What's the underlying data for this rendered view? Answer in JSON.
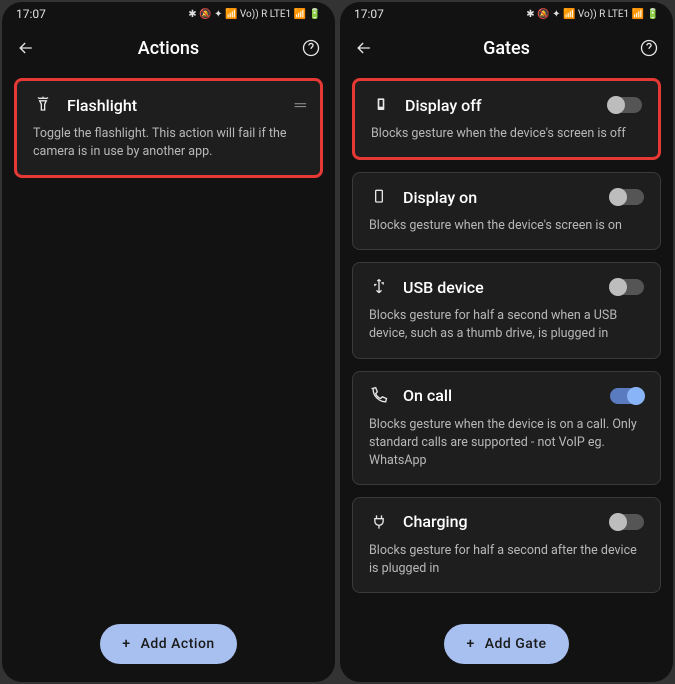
{
  "status": {
    "time": "17:07",
    "indicators": "✱ 🔕 ✦ 📶 Vo)) R LTE1 📶 🔋"
  },
  "left": {
    "title": "Actions",
    "card": {
      "title": "Flashlight",
      "desc": "Toggle the flashlight. This action will fail if the camera is in use by another app."
    },
    "fab": "Add Action"
  },
  "right": {
    "title": "Gates",
    "cards": [
      {
        "title": "Display off",
        "desc": "Blocks gesture when the device's screen is off",
        "on": false,
        "highlight": true,
        "icon": "display-off"
      },
      {
        "title": "Display on",
        "desc": "Blocks gesture when the device's screen is on",
        "on": false,
        "highlight": false,
        "icon": "display-on"
      },
      {
        "title": "USB device",
        "desc": "Blocks gesture for half a second when a USB device, such as a thumb drive, is plugged in",
        "on": false,
        "highlight": false,
        "icon": "usb"
      },
      {
        "title": "On call",
        "desc": "Blocks gesture when the device is on a call. Only standard calls are supported - not VoIP eg. WhatsApp",
        "on": true,
        "highlight": false,
        "icon": "phone"
      },
      {
        "title": "Charging",
        "desc": "Blocks gesture for half a second after the device is plugged in",
        "on": false,
        "highlight": false,
        "icon": "plug"
      }
    ],
    "fab": "Add Gate"
  }
}
